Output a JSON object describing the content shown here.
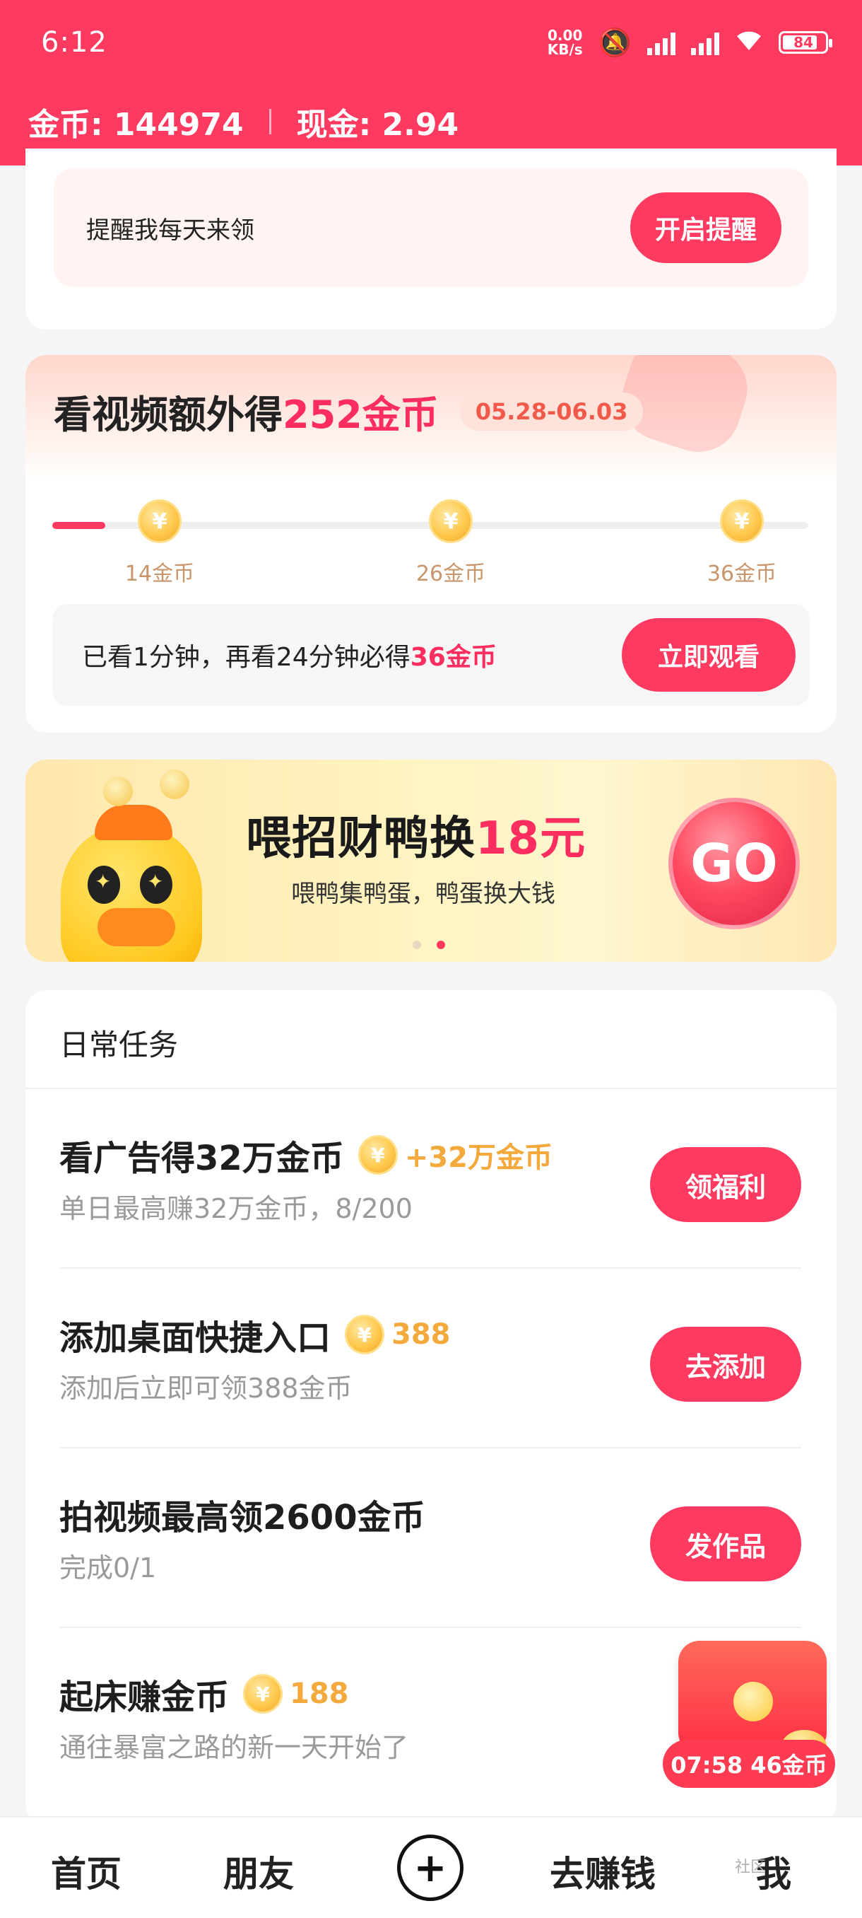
{
  "status_bar": {
    "time": "6:12",
    "net_speed_value": "0.00",
    "net_speed_unit": "KB/s",
    "battery": "84",
    "battery_level": 0.84
  },
  "header": {
    "coins_label": "金币: 144974",
    "cash_label": "现金: 2.94"
  },
  "reminder": {
    "text": "提醒我每天来领",
    "button": "开启提醒"
  },
  "video_task": {
    "title_prefix": "看视频额外得",
    "title_highlight": "252金币",
    "date_range": "05.28-06.03",
    "progress": 0.07,
    "milestones": [
      {
        "coin": "¥",
        "label": "14金币"
      },
      {
        "coin": "¥",
        "label": "26金币"
      },
      {
        "coin": "¥",
        "label": "36金币"
      }
    ],
    "status_prefix": "已看1分钟，再看24分钟必得",
    "status_highlight": "36金币",
    "button": "立即观看"
  },
  "banner": {
    "title_prefix": "喂招财鸭换",
    "title_highlight": "18元",
    "subtitle": "喂鸭集鸭蛋，鸭蛋换大钱",
    "go_button": "GO",
    "active_slide": 2,
    "slide_count": 2
  },
  "daily_tasks": {
    "title": "日常任务",
    "items": [
      {
        "title": "看广告得32万金币",
        "coin": "¥",
        "reward": "+32万金币",
        "subtitle": "单日最高赚32万金币，8/200",
        "button": "领福利"
      },
      {
        "title": "添加桌面快捷入口",
        "coin": "¥",
        "reward": "388",
        "subtitle": "添加后立即可领388金币",
        "button": "去添加"
      },
      {
        "title": "拍视频最高领2600金币",
        "coin": "",
        "reward": "",
        "subtitle": "完成0/1",
        "button": "发作品"
      },
      {
        "title": "起床赚金币",
        "coin": "¥",
        "reward": "188",
        "subtitle": "通往暴富之路的新一天开始了",
        "button": ""
      }
    ]
  },
  "floating_badge": {
    "text": "07:58 46金币"
  },
  "bottom_nav": {
    "home": "首页",
    "friends": "朋友",
    "plus": "+",
    "earn": "去赚钱",
    "me": "我",
    "watermark": "社区"
  },
  "colors": {
    "brand": "#fe3a61",
    "highlight": "#fe2d5f",
    "coin_gold": "#f3a93b"
  }
}
